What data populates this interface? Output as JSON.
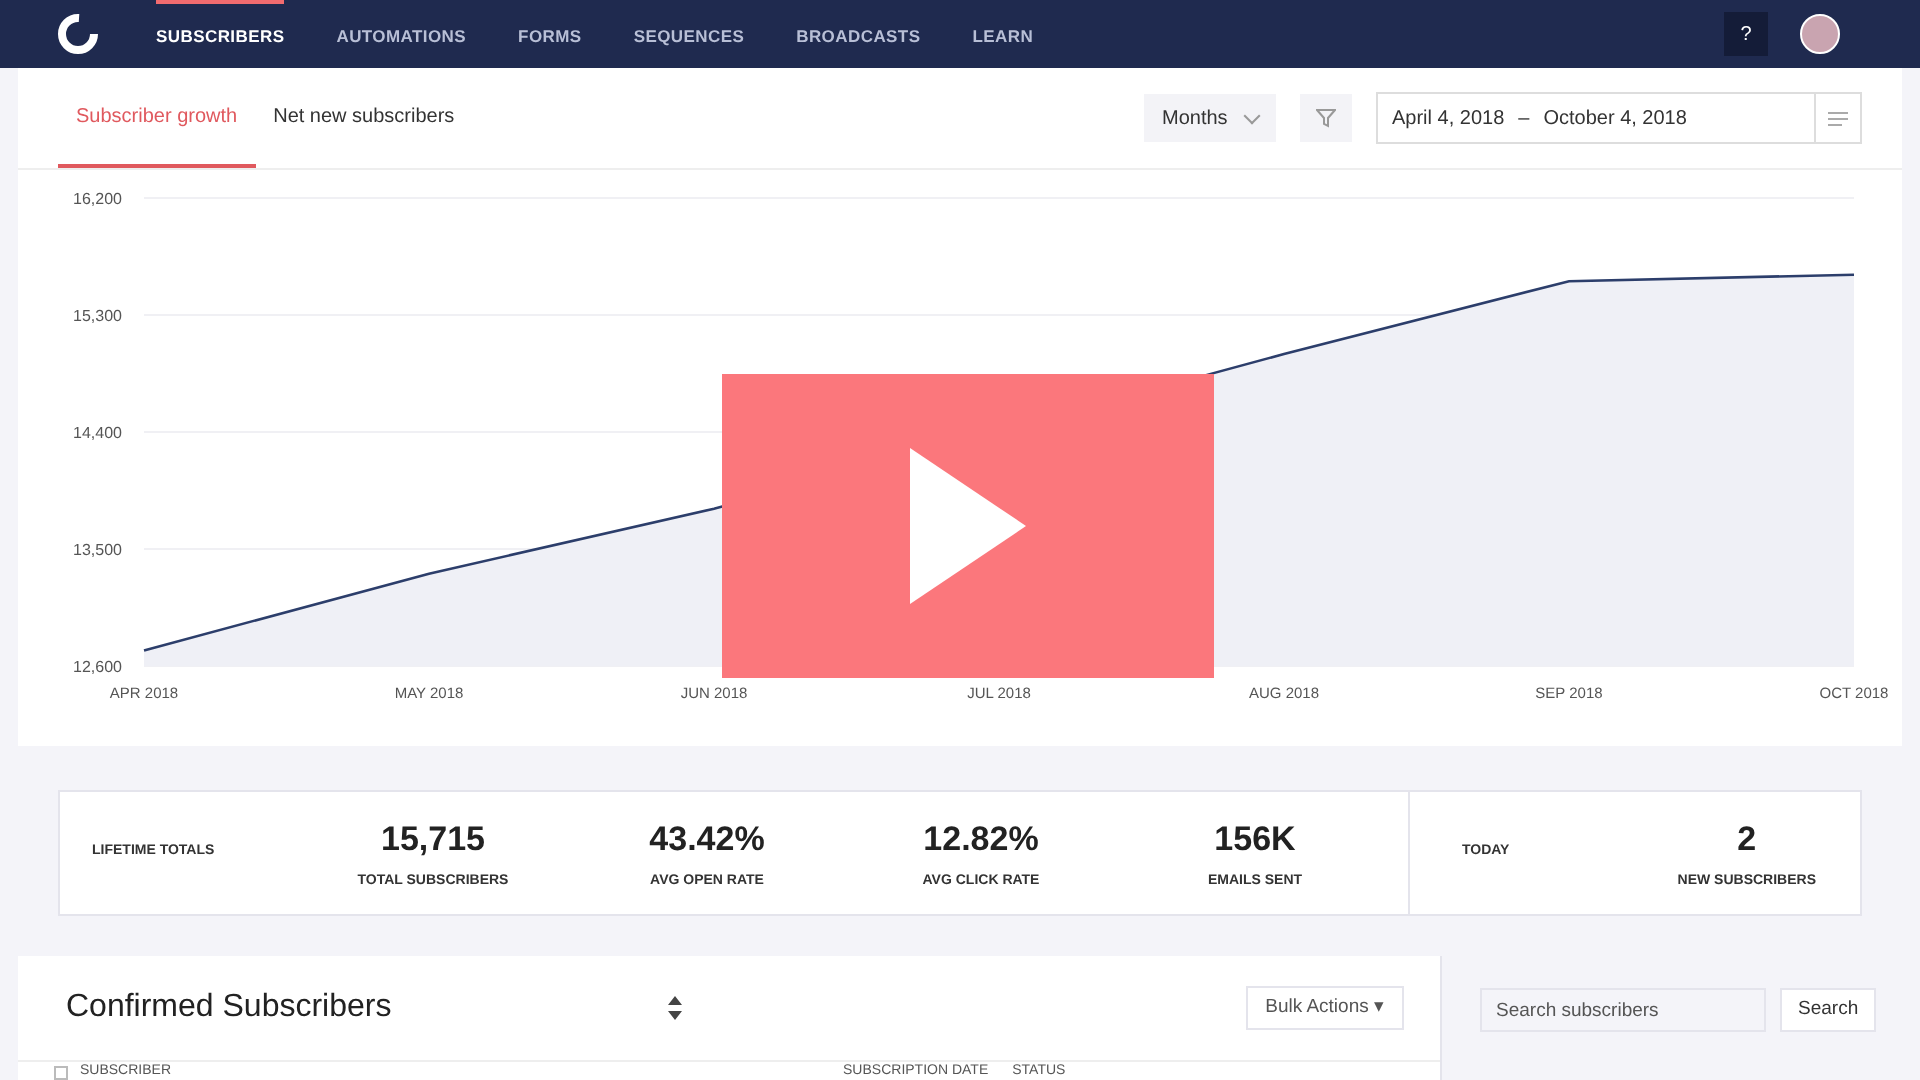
{
  "nav": {
    "items": [
      {
        "label": "SUBSCRIBERS",
        "selected": true
      },
      {
        "label": "AUTOMATIONS",
        "selected": false
      },
      {
        "label": "FORMS",
        "selected": false
      },
      {
        "label": "SEQUENCES",
        "selected": false
      },
      {
        "label": "BROADCASTS",
        "selected": false
      },
      {
        "label": "LEARN",
        "selected": false
      }
    ],
    "help": "?"
  },
  "chart_panel": {
    "tabs": [
      {
        "label": "Subscriber growth",
        "selected": true
      },
      {
        "label": "Net new subscribers",
        "selected": false
      }
    ],
    "period": "Months",
    "date_from": "April 4, 2018",
    "date_sep": "–",
    "date_to": "October 4, 2018",
    "chart_data": {
      "type": "area",
      "categories": [
        "APR 2018",
        "MAY 2018",
        "JUN 2018",
        "JUL 2018",
        "AUG 2018",
        "SEP 2018",
        "OCT 2018"
      ],
      "grid": true,
      "series": [
        {
          "color": "#2c3e6b",
          "values": [
            12720,
            13310,
            13810,
            null,
            15000,
            15560,
            15610
          ]
        }
      ],
      "ylim": [
        12600,
        16200
      ],
      "yticks": [
        {
          "value": 12600,
          "label": "12,600"
        },
        {
          "value": 13500,
          "label": "13,500"
        },
        {
          "value": 14400,
          "label": "14,400"
        },
        {
          "value": 15300,
          "label": "15,300"
        },
        {
          "value": 16200,
          "label": "16,200"
        }
      ]
    }
  },
  "totals": {
    "label": "LIFETIME TOTALS",
    "stats": [
      {
        "value": "15,715",
        "label": "TOTAL SUBSCRIBERS"
      },
      {
        "value": "43.42%",
        "label": "AVG OPEN RATE"
      },
      {
        "value": "12.82%",
        "label": "AVG CLICK RATE"
      },
      {
        "value": "156K",
        "label": "EMAILS SENT"
      }
    ],
    "today_label": "TODAY",
    "today": {
      "value": "2",
      "label": "NEW SUBSCRIBERS"
    }
  },
  "list": {
    "title": "Confirmed Subscribers",
    "bulk": "Bulk Actions",
    "bulk_caret": "▾",
    "select_all": {
      "checked": false
    },
    "columns": [
      "SUBSCRIBER",
      "SUBSCRIPTION DATE",
      "STATUS"
    ]
  },
  "search": {
    "placeholder": "Search subscribers",
    "button": "Search"
  }
}
